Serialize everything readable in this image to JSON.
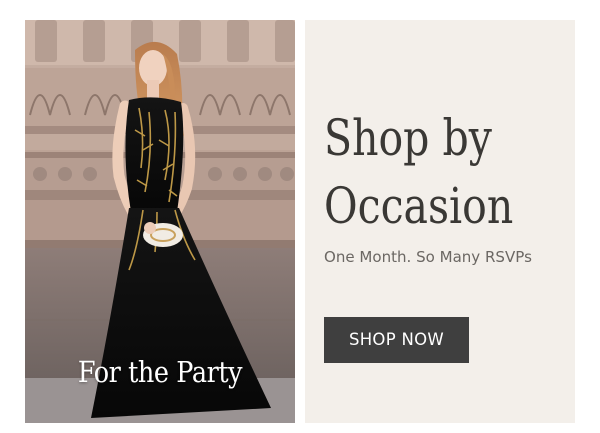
{
  "photo": {
    "caption": "For the Party",
    "image": "woman-in-black-gold-embellished-tulle-gown"
  },
  "promo": {
    "headline_line1": "Shop by",
    "headline_line2": "Occasion",
    "subheadline": "One Month. So Many RSVPs",
    "cta_label": "SHOP NOW"
  },
  "colors": {
    "panel_background": "#f3efea",
    "headline": "#3a3835",
    "subheadline": "#6b6763",
    "button_background": "#3f3f3f",
    "button_text": "#ffffff",
    "caption_text": "#ffffff"
  }
}
